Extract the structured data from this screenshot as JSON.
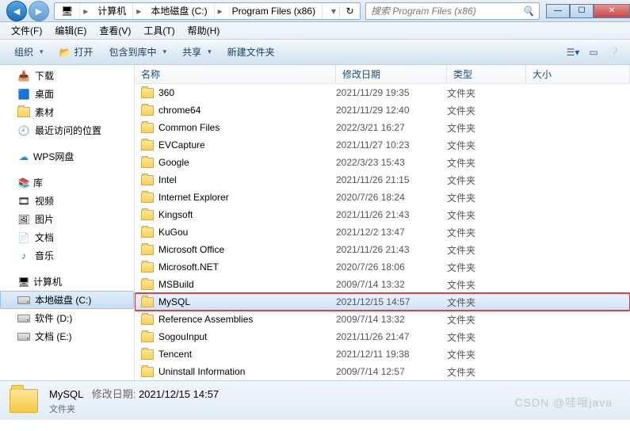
{
  "breadcrumb": {
    "segments": [
      "计算机",
      "本地磁盘 (C:)",
      "Program Files (x86)"
    ]
  },
  "search": {
    "placeholder": "搜索 Program Files (x86)"
  },
  "menus": {
    "file": "文件(F)",
    "edit": "编辑(E)",
    "view": "查看(V)",
    "tools": "工具(T)",
    "help": "帮助(H)"
  },
  "toolbar": {
    "organize": "组织",
    "open": "打开",
    "include": "包含到库中",
    "share": "共享",
    "newfolder": "新建文件夹"
  },
  "sidebar": {
    "downloads": "下载",
    "desktop": "桌面",
    "materials": "素材",
    "recent": "最近访问的位置",
    "wps": "WPS网盘",
    "library": "库",
    "video": "视频",
    "pictures": "图片",
    "documents": "文档",
    "music": "音乐",
    "computer": "计算机",
    "drive_c": "本地磁盘 (C:)",
    "drive_d": "软件 (D:)",
    "drive_e": "文档 (E:)"
  },
  "columns": {
    "name": "名称",
    "date": "修改日期",
    "type": "类型",
    "size": "大小"
  },
  "folder_type": "文件夹",
  "items": [
    {
      "name": "360",
      "date": "2021/11/29 19:35"
    },
    {
      "name": "chrome64",
      "date": "2021/11/29 12:40"
    },
    {
      "name": "Common Files",
      "date": "2022/3/21 16:27"
    },
    {
      "name": "EVCapture",
      "date": "2021/11/27 10:23"
    },
    {
      "name": "Google",
      "date": "2022/3/23 15:43"
    },
    {
      "name": "Intel",
      "date": "2021/11/26 21:15"
    },
    {
      "name": "Internet Explorer",
      "date": "2020/7/26 18:24"
    },
    {
      "name": "Kingsoft",
      "date": "2021/11/26 21:43"
    },
    {
      "name": "KuGou",
      "date": "2021/12/2 13:47"
    },
    {
      "name": "Microsoft Office",
      "date": "2021/11/26 21:43"
    },
    {
      "name": "Microsoft.NET",
      "date": "2020/7/26 18:06"
    },
    {
      "name": "MSBuild",
      "date": "2009/7/14 13:32"
    },
    {
      "name": "MySQL",
      "date": "2021/12/15 14:57",
      "selected": true,
      "highlighted": true
    },
    {
      "name": "Reference Assemblies",
      "date": "2009/7/14 13:32"
    },
    {
      "name": "SogouInput",
      "date": "2021/11/26 21:47"
    },
    {
      "name": "Tencent",
      "date": "2021/12/11 19:38"
    },
    {
      "name": "Uninstall Information",
      "date": "2009/7/14 12:57"
    }
  ],
  "status": {
    "name": "MySQL",
    "date_label": "修改日期:",
    "date_value": "2021/12/15 14:57",
    "type": "文件夹"
  },
  "watermark": "CSDN @哇哦java"
}
